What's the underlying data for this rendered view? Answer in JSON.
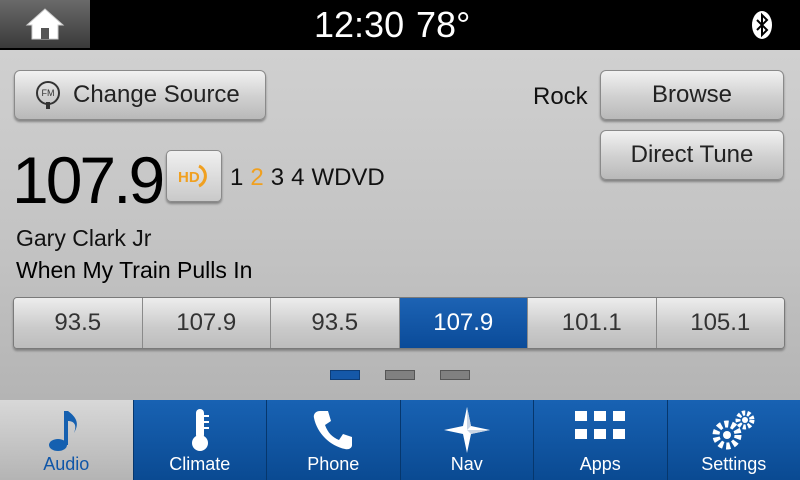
{
  "status_bar": {
    "time": "12:30",
    "temperature": "78°",
    "home_icon": "home-icon",
    "bluetooth_icon": "bluetooth-icon"
  },
  "source": {
    "change_source_label": "Change Source",
    "source_icon": "fm-radio-icon"
  },
  "station": {
    "frequency": "107.9",
    "hd_icon": "hd-radio-icon",
    "subchannels": [
      {
        "label": "1",
        "active": false
      },
      {
        "label": "2",
        "active": true
      },
      {
        "label": "3",
        "active": false
      },
      {
        "label": "4",
        "active": false
      }
    ],
    "call_sign": "WDVD",
    "genre": "Rock",
    "artist": "Gary Clark Jr",
    "song": "When My Train Pulls In"
  },
  "actions": {
    "browse_label": "Browse",
    "direct_tune_label": "Direct Tune"
  },
  "presets": [
    {
      "label": "93.5",
      "selected": false
    },
    {
      "label": "107.9",
      "selected": false
    },
    {
      "label": "93.5",
      "selected": false
    },
    {
      "label": "107.9",
      "selected": true
    },
    {
      "label": "101.1",
      "selected": false
    },
    {
      "label": "105.1",
      "selected": false
    }
  ],
  "preset_pages": {
    "count": 3,
    "current": 1
  },
  "nav": [
    {
      "label": "Audio",
      "icon": "music-note-icon",
      "active": true
    },
    {
      "label": "Climate",
      "icon": "thermometer-icon",
      "active": false
    },
    {
      "label": "Phone",
      "icon": "phone-icon",
      "active": false
    },
    {
      "label": "Nav",
      "icon": "compass-star-icon",
      "active": false
    },
    {
      "label": "Apps",
      "icon": "apps-grid-icon",
      "active": false
    },
    {
      "label": "Settings",
      "icon": "gears-icon",
      "active": false
    }
  ],
  "colors": {
    "accent_blue": "#0a4b99",
    "hd_orange": "#f0a020",
    "active_subchannel": "#f0a020"
  }
}
